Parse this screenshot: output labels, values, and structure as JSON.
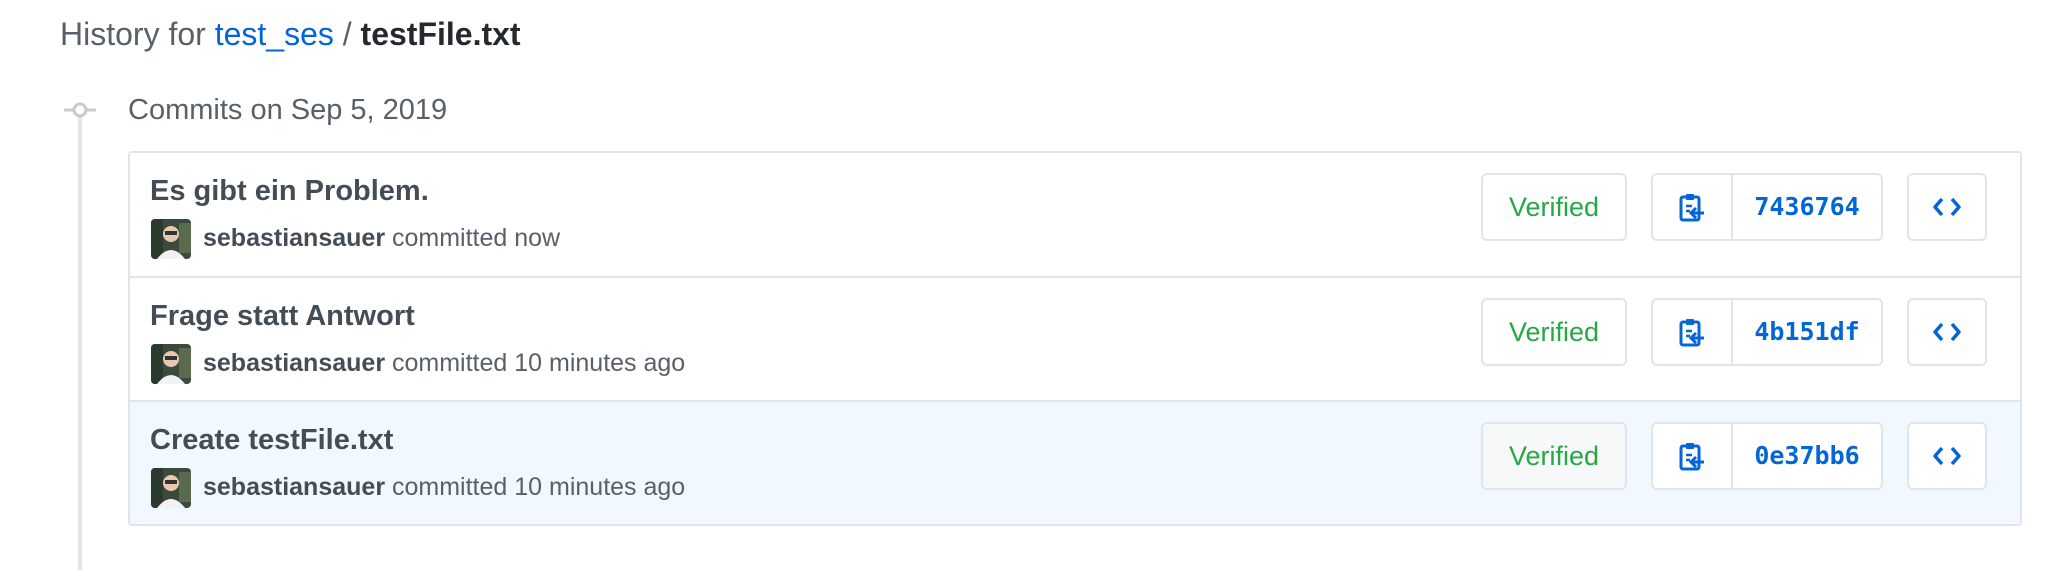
{
  "header": {
    "prefix": "History for",
    "repo": "test_ses",
    "separator": "/",
    "file": "testFile.txt"
  },
  "group": {
    "title": "Commits on Sep 5, 2019",
    "icon": "git-commit-icon"
  },
  "commits": [
    {
      "title": "Es gibt ein Problem.",
      "author": "sebastiansauer",
      "time": "committed now",
      "verified": "Verified",
      "sha": "7436764"
    },
    {
      "title": "Frage statt Antwort",
      "author": "sebastiansauer",
      "time": "committed 10 minutes ago",
      "verified": "Verified",
      "sha": "4b151df"
    },
    {
      "title": "Create testFile.txt",
      "author": "sebastiansauer",
      "time": "committed 10 minutes ago",
      "verified": "Verified",
      "sha": "0e37bb6"
    }
  ],
  "icons": {
    "copy": "clipboard-copy-icon",
    "browse": "code-browse-icon"
  },
  "colors": {
    "link": "#0366d6",
    "verified": "#28a745",
    "highlight_row": "#f1f8ff",
    "border": "#e1e4e8"
  }
}
